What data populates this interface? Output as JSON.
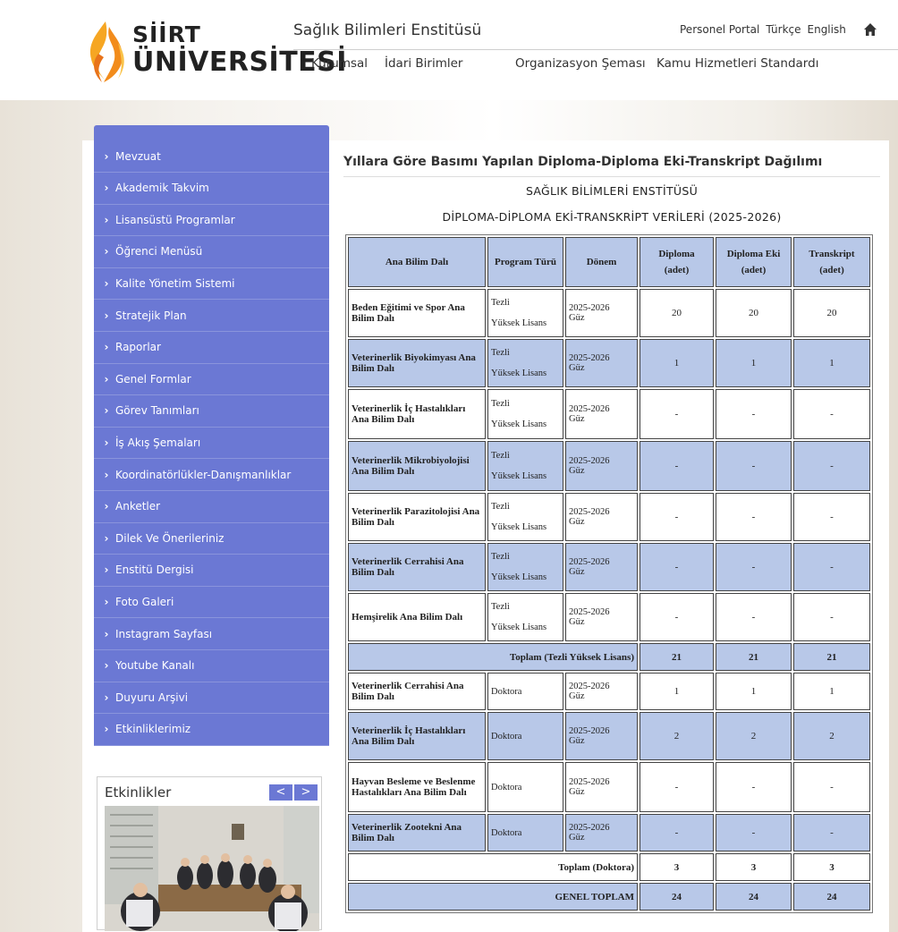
{
  "header": {
    "logo_line1": "SİİRT",
    "logo_line2": "ÜNİVERSİTESİ",
    "institute_title": "Sağlık Bilimleri Enstitüsü",
    "top_links": [
      "Personel Portal",
      "Türkçe",
      "English"
    ],
    "nav": [
      "Kurumsal",
      "İdari Birimler",
      "Organizasyon Şeması",
      "Kamu Hizmetleri Standardı"
    ]
  },
  "sidebar": {
    "items": [
      "Mevzuat",
      "Akademik Takvim",
      "Lisansüstü Programlar",
      "Öğrenci Menüsü",
      "Kalite Yönetim Sistemi",
      "Stratejik Plan",
      "Raporlar",
      "Genel Formlar",
      "Görev Tanımları",
      "İş Akış Şemaları",
      "Koordinatörlükler-Danışmanlıklar",
      "Anketler",
      "Dilek Ve Önerileriniz",
      "Enstitü Dergisi",
      "Foto Galeri",
      "Instagram Sayfası",
      "Youtube Kanalı",
      "Duyuru Arşivi",
      "Etkinliklerimiz"
    ]
  },
  "events": {
    "title": "Etkinlikler",
    "prev": "<",
    "next": ">"
  },
  "main": {
    "heading": "Yıllara Göre Basımı Yapılan Diploma-Diploma Eki-Transkript Dağılımı",
    "subtitle1": "SAĞLIK BİLİMLERİ ENSTİTÜSÜ",
    "subtitle2": "DİPLOMA-DİPLOMA EKİ-TRANSKRİPT VERİLERİ (2025-2026)"
  },
  "table": {
    "headers": {
      "dept": "Ana Bilim Dalı",
      "program": "Program Türü",
      "period": "Dönem",
      "diploma": "Diploma",
      "diploma_eki": "Diploma Eki",
      "transkript": "Transkript",
      "unit": "(adet)"
    },
    "tezli_rows": [
      {
        "dept": "Beden Eğitimi ve Spor Ana Bilim Dalı",
        "program1": "Tezli",
        "program2": "Yüksek Lisans",
        "period1": "2025-2026",
        "period2": "Güz",
        "diploma": "20",
        "diploma_eki": "20",
        "transkript": "20"
      },
      {
        "dept": "Veterinerlik Biyokimyası Ana Bilim Dalı",
        "program1": "Tezli",
        "program2": "Yüksek Lisans",
        "period1": "2025-2026",
        "period2": "Güz",
        "diploma": "1",
        "diploma_eki": "1",
        "transkript": "1"
      },
      {
        "dept": "Veterinerlik İç Hastalıkları Ana Bilim Dalı",
        "program1": "Tezli",
        "program2": "Yüksek Lisans",
        "period1": "2025-2026",
        "period2": "Güz",
        "diploma": "-",
        "diploma_eki": "-",
        "transkript": "-"
      },
      {
        "dept": "Veterinerlik Mikrobiyolojisi Ana Bilim Dalı",
        "program1": "Tezli",
        "program2": "Yüksek Lisans",
        "period1": "2025-2026",
        "period2": "Güz",
        "diploma": "-",
        "diploma_eki": "-",
        "transkript": "-"
      },
      {
        "dept": "Veterinerlik Parazitolojisi Ana Bilim Dalı",
        "program1": "Tezli",
        "program2": "Yüksek Lisans",
        "period1": "2025-2026",
        "period2": "Güz",
        "diploma": "-",
        "diploma_eki": "-",
        "transkript": "-"
      },
      {
        "dept": "Veterinerlik Cerrahisi Ana Bilim Dalı",
        "program1": "Tezli",
        "program2": "Yüksek Lisans",
        "period1": "2025-2026",
        "period2": "Güz",
        "diploma": "-",
        "diploma_eki": "-",
        "transkript": "-"
      },
      {
        "dept": "Hemşirelik Ana Bilim Dalı",
        "program1": "Tezli",
        "program2": "Yüksek Lisans",
        "period1": "2025-2026",
        "period2": "Güz",
        "diploma": "-",
        "diploma_eki": "-",
        "transkript": "-"
      }
    ],
    "tezli_total": {
      "label": "Toplam (Tezli Yüksek Lisans)",
      "diploma": "21",
      "diploma_eki": "21",
      "transkript": "21"
    },
    "doktora_rows": [
      {
        "dept": "Veterinerlik Cerrahisi Ana Bilim Dalı",
        "program": "Doktora",
        "period1": "2025-2026",
        "period2": "Güz",
        "diploma": "1",
        "diploma_eki": "1",
        "transkript": "1"
      },
      {
        "dept": "Veterinerlik İç Hastalıkları Ana Bilim Dalı",
        "program": "Doktora",
        "period1": "2025-2026",
        "period2": "Güz",
        "diploma": "2",
        "diploma_eki": "2",
        "transkript": "2"
      },
      {
        "dept": "Hayvan Besleme ve Beslenme Hastalıkları Ana Bilim Dalı",
        "program": "Doktora",
        "period1": "2025-2026",
        "period2": "Güz",
        "diploma": "-",
        "diploma_eki": "-",
        "transkript": "-"
      },
      {
        "dept": "Veterinerlik Zootekni Ana Bilim Dalı",
        "program": "Doktora",
        "period1": "2025-2026",
        "period2": "Güz",
        "diploma": "-",
        "diploma_eki": "-",
        "transkript": "-"
      }
    ],
    "doktora_total": {
      "label": "Toplam (Doktora)",
      "diploma": "3",
      "diploma_eki": "3",
      "transkript": "3"
    },
    "grand_total": {
      "label": "GENEL TOPLAM",
      "diploma": "24",
      "diploma_eki": "24",
      "transkript": "24"
    }
  },
  "colors": {
    "sidebar": "#6b78d4",
    "table_shade": "#b8c8e8",
    "flame_orange": "#f28c1c"
  }
}
